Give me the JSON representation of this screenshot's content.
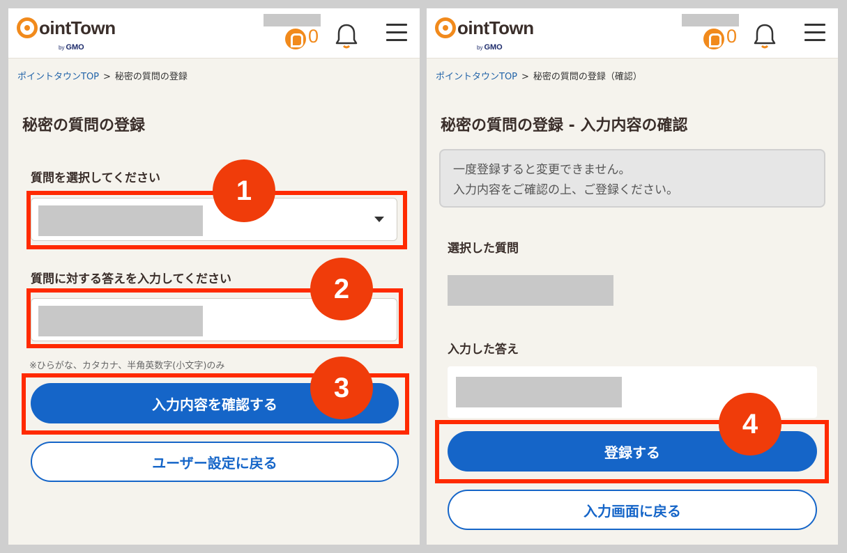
{
  "header": {
    "logo_text": "ointTown",
    "logo_by": "by",
    "logo_company": "GMO",
    "point_count": "0"
  },
  "left": {
    "breadcrumb": {
      "home": "ポイントタウンTOP",
      "separator": ">",
      "current": "秘密の質問の登録"
    },
    "title": "秘密の質問の登録",
    "question_label": "質問を選択してください",
    "answer_label": "質問に対する答えを入力してください",
    "note": "※ひらがな、カタカナ、半角英数字(小文字)のみ",
    "confirm_button": "入力内容を確認する",
    "back_button": "ユーザー設定に戻る"
  },
  "right": {
    "breadcrumb": {
      "home": "ポイントタウンTOP",
      "separator": ">",
      "current": "秘密の質問の登録（確認）"
    },
    "title": "秘密の質問の登録 - 入力内容の確認",
    "notice_line1": "一度登録すると変更できません。",
    "notice_line2": "入力内容をご確認の上、ご登録ください。",
    "selected_question_label": "選択した質問",
    "entered_answer_label": "入力した答え",
    "register_button": "登録する",
    "back_button": "入力画面に戻る"
  },
  "callouts": [
    "1",
    "2",
    "3",
    "4"
  ],
  "colors": {
    "brand_orange": "#f18a1c",
    "primary_blue": "#1565c8",
    "highlight_red": "#ff2a00",
    "callout_red": "#f03c0a",
    "page_bg": "#f5f3ed"
  }
}
